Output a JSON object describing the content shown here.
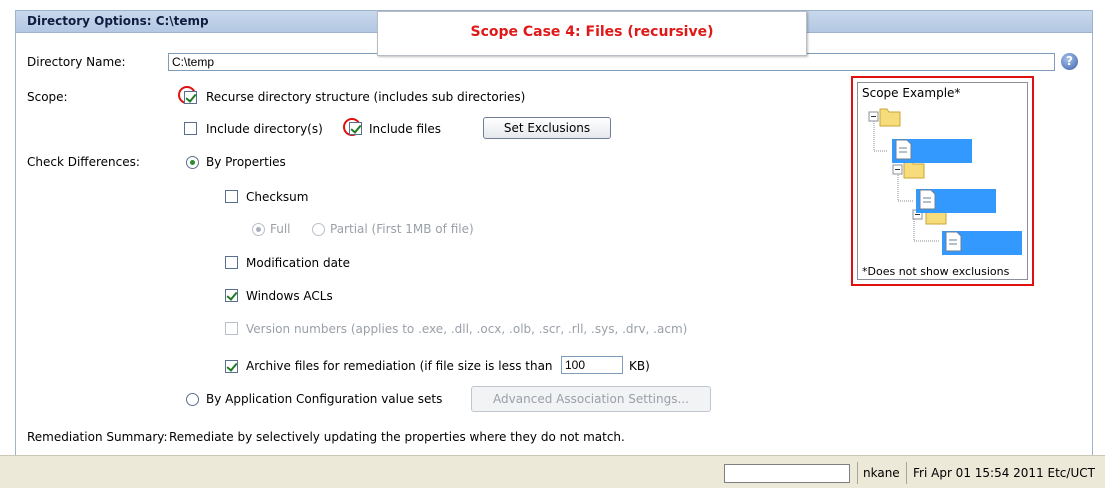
{
  "header": {
    "title": "Directory Options: C:\\temp"
  },
  "callout": {
    "text": "Scope Case 4: Files (recursive)"
  },
  "directory": {
    "label": "Directory Name:",
    "value": "C:\\temp",
    "help_icon": "help-circle-icon"
  },
  "scope": {
    "label": "Scope:",
    "recurse": {
      "label": "Recurse directory structure (includes sub directories)",
      "checked": true
    },
    "include_dirs": {
      "label": "Include directory(s)",
      "checked": false
    },
    "include_files": {
      "label": "Include files",
      "checked": true
    },
    "set_exclusions_label": "Set Exclusions"
  },
  "check_diff": {
    "label": "Check Differences:",
    "by_properties": {
      "label": "By Properties",
      "selected": true
    },
    "checksum": {
      "label": "Checksum",
      "checked": false
    },
    "full": {
      "label": "Full",
      "selected": true,
      "disabled": true
    },
    "partial": {
      "label": "Partial (First 1MB of file)",
      "selected": false,
      "disabled": true
    },
    "modification_date": {
      "label": "Modification date",
      "checked": false
    },
    "windows_acls": {
      "label": "Windows ACLs",
      "checked": true
    },
    "version_numbers": {
      "label": "Version numbers (applies to .exe, .dll, .ocx, .olb, .scr, .rll, .sys, .drv, .acm)",
      "checked": false,
      "disabled": true
    },
    "archive": {
      "label_before": "Archive files for remediation  (if file size is less than",
      "value": "100",
      "label_after": "KB)",
      "checked": true
    },
    "by_app_config": {
      "label": "By Application Configuration value sets",
      "selected": false
    },
    "advanced_label": "Advanced Association Settings..."
  },
  "remediation": {
    "label": "Remediation Summary:",
    "text": "Remediate by selectively updating the properties where they do not match."
  },
  "scope_example": {
    "title": "Scope Example*",
    "footer": "*Does not show exclusions",
    "highlight_color": "#3399ff"
  },
  "statusbar": {
    "user": "nkane",
    "datetime": "Fri Apr 01 15:54 2011 Etc/UCT"
  },
  "colors": {
    "accent_red": "#e01010",
    "header_bg": "#c9d8ec"
  }
}
